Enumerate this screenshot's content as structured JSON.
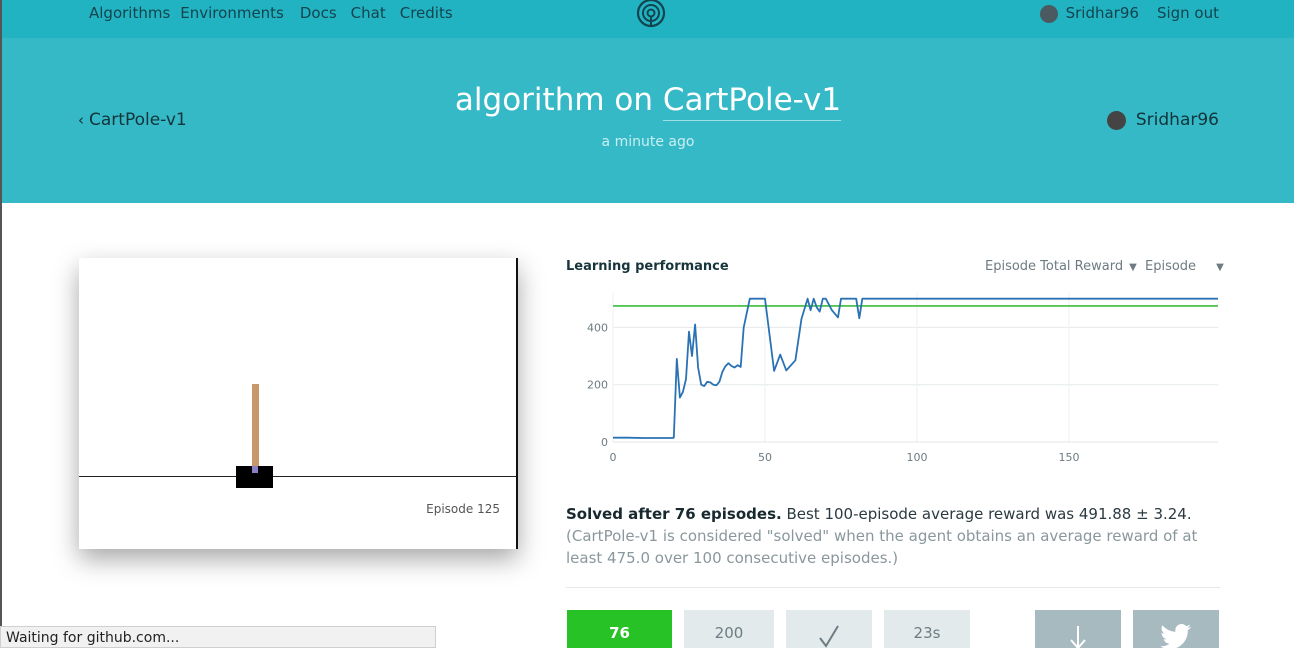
{
  "nav": {
    "items": [
      "Algorithms",
      "Environments",
      "Docs",
      "Chat",
      "Credits"
    ],
    "user": "Sridhar96",
    "sign_out": "Sign out"
  },
  "hero": {
    "back_label": "CartPole-v1",
    "title_prefix": "algorithm on ",
    "title_env": "CartPole-v1",
    "time": "a minute ago",
    "user": "Sridhar96"
  },
  "simulation": {
    "episode_label": "Episode 125"
  },
  "performance": {
    "title": "Learning performance",
    "metric_select": "Episode Total Reward",
    "x_select": "Episode"
  },
  "chart_data": {
    "type": "line",
    "x_ticks": [
      0,
      50,
      100,
      150
    ],
    "y_ticks": [
      0,
      200,
      400
    ],
    "xlim": [
      0,
      199
    ],
    "ylim": [
      0,
      520
    ],
    "grid": true,
    "threshold": 475,
    "colors": {
      "series": "#2a72b3",
      "threshold": "#3cbd3a"
    },
    "series": [
      {
        "x": [
          0,
          5,
          10,
          15,
          19,
          20,
          21,
          22,
          23,
          24,
          25,
          26,
          27,
          28,
          29,
          30,
          31,
          32,
          33,
          34,
          35,
          36,
          37,
          38,
          39,
          40,
          41,
          42,
          43,
          45,
          47,
          50,
          53,
          55,
          57,
          60,
          62,
          64,
          65,
          66,
          67,
          68,
          69,
          70,
          72,
          74,
          75,
          76,
          77,
          78,
          79,
          80,
          81,
          82,
          84,
          85,
          86,
          87,
          88,
          89,
          90,
          91,
          92,
          93,
          94,
          95,
          97,
          100,
          102,
          103,
          104,
          105,
          106,
          110,
          111,
          112,
          113,
          114,
          115,
          116,
          117,
          120,
          125,
          130,
          135,
          140,
          141,
          142,
          143,
          144,
          145,
          146,
          147,
          148,
          149,
          150,
          151,
          152,
          153,
          154,
          155,
          156,
          157,
          158,
          159,
          160,
          161,
          162,
          163,
          164,
          165,
          166,
          167,
          168,
          169,
          170,
          175,
          180,
          185,
          190,
          195,
          199
        ],
        "y": [
          15,
          15,
          14,
          14,
          14,
          15,
          290,
          155,
          175,
          220,
          385,
          300,
          410,
          260,
          200,
          195,
          210,
          208,
          200,
          198,
          210,
          245,
          265,
          275,
          265,
          260,
          268,
          262,
          400,
          500,
          500,
          500,
          248,
          305,
          250,
          285,
          430,
          500,
          460,
          500,
          470,
          455,
          500,
          500,
          460,
          435,
          500,
          500,
          500,
          500,
          500,
          500,
          432,
          500,
          500,
          500,
          500,
          500,
          500,
          500,
          500,
          500,
          500,
          500,
          500,
          500,
          500,
          500,
          500,
          500,
          500,
          500,
          500,
          500,
          500,
          500,
          500,
          500,
          500,
          500,
          500,
          500,
          500,
          500,
          500,
          500,
          500,
          500,
          500,
          500,
          500,
          500,
          500,
          500,
          500,
          500,
          500,
          500,
          500,
          500,
          500,
          500,
          500,
          500,
          500,
          500,
          500,
          500,
          500,
          500,
          500,
          500,
          500,
          500,
          500,
          500,
          500,
          500,
          500,
          500,
          500,
          500
        ]
      }
    ]
  },
  "summary": {
    "solved": "Solved after 76 episodes.",
    "best": " Best 100-episode average reward was 491.88 ± 3.24.",
    "note": " (CartPole-v1 is considered \"solved\" when the agent obtains an average reward of at least 475.0 over 100 consecutive episodes.)"
  },
  "stats": {
    "solved_episodes": "76",
    "total_episodes": "200",
    "reviewed_icon": "checkmark-icon",
    "duration": "23s"
  },
  "status_bar": "Waiting for github.com..."
}
